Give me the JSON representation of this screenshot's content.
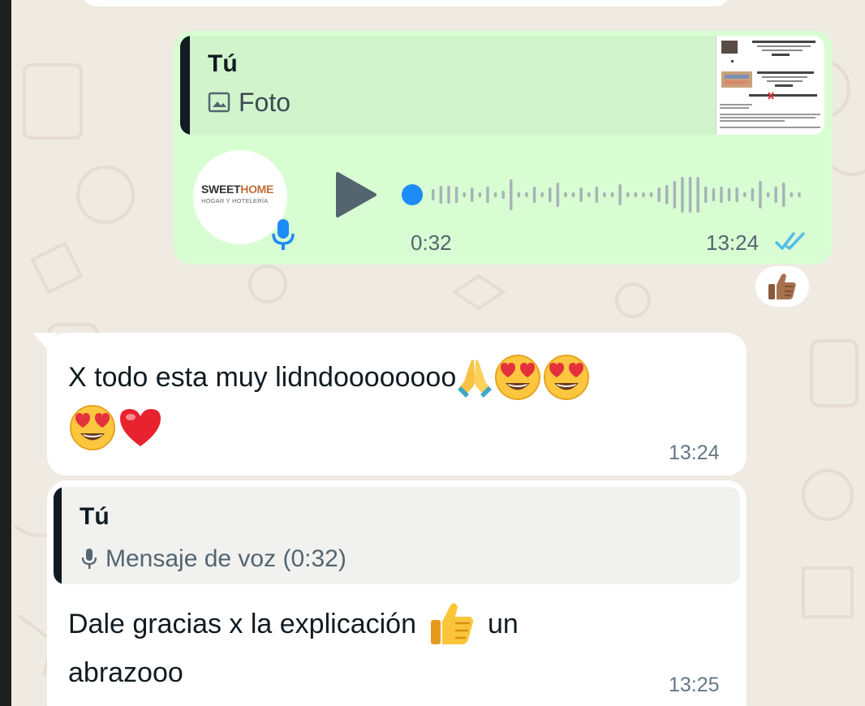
{
  "outgoing_voice": {
    "quote_name": "Tú",
    "quote_label": "Foto",
    "avatar_brand_line1": "SWEETHOME",
    "avatar_brand_line2": "HOGAR Y HOTELERÍA",
    "duration": "0:32",
    "time": "13:24",
    "status_icon": "double-check-read-icon",
    "reaction": "thumbs-up",
    "playback_progress": 0
  },
  "messages": [
    {
      "line1": "X todo esta muy lidndoooooooo",
      "line2_emojis": [
        "heart-eyes",
        "red-heart"
      ],
      "line1_emojis": [
        "folded-hands",
        "heart-eyes",
        "heart-eyes"
      ],
      "time": "13:24"
    },
    {
      "quote_name": "Tú",
      "quote_label": "Mensaje de voz (0:32)",
      "line1": "Dale gracias x la explicación",
      "line1_tail": "un",
      "line2": "abrazooo",
      "line1_emojis": [
        "thumbs-up"
      ],
      "time": "13:25"
    }
  ],
  "colors": {
    "background": "#efeae2",
    "outgoing_bubble": "#d9fdd3",
    "incoming_bubble": "#ffffff",
    "accent_blue": "#1d8cf8",
    "read_ticks": "#53bdeb"
  }
}
